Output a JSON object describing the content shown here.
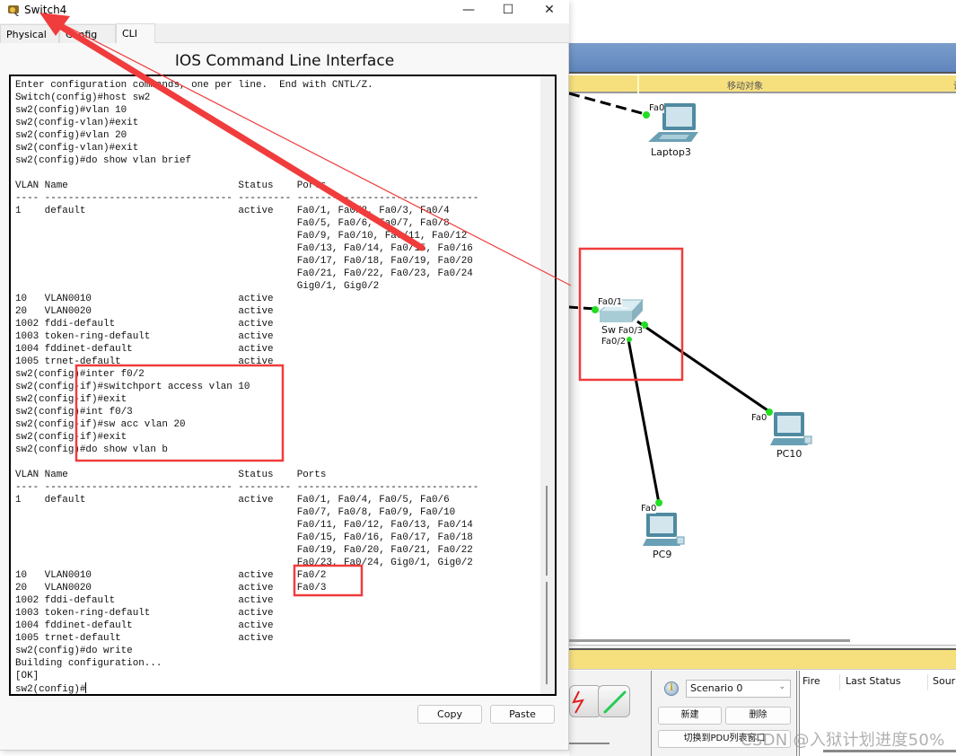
{
  "dialog": {
    "title": "Switch4",
    "tabs": [
      {
        "label": "Physical",
        "active": false
      },
      {
        "label": "Config",
        "active": false
      },
      {
        "label": "CLI",
        "active": true
      }
    ],
    "heading": "IOS Command Line Interface",
    "terminal_lines": [
      "Enter configuration commands, one per line.  End with CNTL/Z.",
      "Switch(config)#host sw2",
      "sw2(config)#vlan 10",
      "sw2(config-vlan)#exit",
      "sw2(config)#vlan 20",
      "sw2(config-vlan)#exit",
      "sw2(config)#do show vlan brief",
      "",
      "VLAN Name                             Status    Ports",
      "---- -------------------------------- --------- -------------------------------",
      "1    default                          active    Fa0/1, Fa0/2, Fa0/3, Fa0/4",
      "                                                Fa0/5, Fa0/6, Fa0/7, Fa0/8",
      "                                                Fa0/9, Fa0/10, Fa0/11, Fa0/12",
      "                                                Fa0/13, Fa0/14, Fa0/15, Fa0/16",
      "                                                Fa0/17, Fa0/18, Fa0/19, Fa0/20",
      "                                                Fa0/21, Fa0/22, Fa0/23, Fa0/24",
      "                                                Gig0/1, Gig0/2",
      "10   VLAN0010                         active",
      "20   VLAN0020                         active",
      "1002 fddi-default                     active",
      "1003 token-ring-default               active",
      "1004 fddinet-default                  active",
      "1005 trnet-default                    active",
      "sw2(config)#inter f0/2",
      "sw2(config-if)#switchport access vlan 10",
      "sw2(config-if)#exit",
      "sw2(config)#int f0/3",
      "sw2(config-if)#sw acc vlan 20",
      "sw2(config-if)#exit",
      "sw2(config)#do show vlan b",
      "",
      "VLAN Name                             Status    Ports",
      "---- -------------------------------- --------- -------------------------------",
      "1    default                          active    Fa0/1, Fa0/4, Fa0/5, Fa0/6",
      "                                                Fa0/7, Fa0/8, Fa0/9, Fa0/10",
      "                                                Fa0/11, Fa0/12, Fa0/13, Fa0/14",
      "                                                Fa0/15, Fa0/16, Fa0/17, Fa0/18",
      "                                                Fa0/19, Fa0/20, Fa0/21, Fa0/22",
      "                                                Fa0/23, Fa0/24, Gig0/1, Gig0/2",
      "10   VLAN0010                         active    Fa0/2",
      "20   VLAN0020                         active    Fa0/3",
      "1002 fddi-default                     active",
      "1003 token-ring-default               active",
      "1004 fddinet-default                  active",
      "1005 trnet-default                    active",
      "sw2(config)#do write",
      "Building configuration...",
      "[OK]"
    ],
    "prompt": "sw2(config)#",
    "copy_label": "Copy",
    "paste_label": "Paste"
  },
  "workspace": {
    "toolbar_label": "移动对象",
    "toolbar_label_cut": "设",
    "devices": [
      {
        "name": "Laptop3",
        "type": "laptop",
        "ports": [
          "Fa0"
        ]
      },
      {
        "name": "Sw",
        "type": "switch",
        "ports": [
          "Fa0/1",
          "Fa0/2",
          "Fa0/3"
        ]
      },
      {
        "name": "PC10",
        "type": "pc",
        "ports": [
          "Fa0"
        ]
      },
      {
        "name": "PC9",
        "type": "pc",
        "ports": [
          "Fa0"
        ]
      }
    ],
    "links": [
      {
        "from": "external",
        "to": "Laptop3.Fa0",
        "style": "dashed"
      },
      {
        "from": "external",
        "to": "Sw.Fa0/1",
        "style": "solid"
      },
      {
        "from": "Sw.Fa0/2",
        "to": "PC9.Fa0",
        "style": "solid"
      },
      {
        "from": "Sw.Fa0/3",
        "to": "PC10.Fa0",
        "style": "solid"
      }
    ]
  },
  "bottom_panel": {
    "info_glyph": "i",
    "scenario": "Scenario 0",
    "new_label": "新建",
    "delete_label": "删除",
    "pdu_toggle_label": "切换到PDU列表窗口",
    "pdu_columns": [
      "Fire",
      "Last Status",
      "Sour"
    ]
  },
  "watermark": "CSDN @入狱计划进度50%",
  "colors": {
    "annotation_red": "#f03c3c",
    "link_up_green": "#22dd22",
    "toolbar_blue": "#6a8fc4",
    "toolbar_yellow": "#f6e07e"
  }
}
